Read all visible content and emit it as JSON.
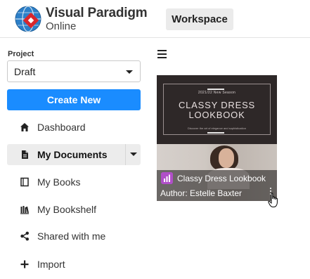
{
  "header": {
    "brand_line1": "Visual Paradigm",
    "brand_line2": "Online",
    "workspace_label": "Workspace"
  },
  "sidebar": {
    "project_label": "Project",
    "project_value": "Draft",
    "create_new_label": "Create New",
    "items": [
      {
        "label": "Dashboard",
        "icon": "home-icon"
      },
      {
        "label": "My Documents",
        "icon": "document-icon",
        "active": true
      },
      {
        "label": "My Books",
        "icon": "book-icon"
      },
      {
        "label": "My Bookshelf",
        "icon": "bookshelf-icon"
      },
      {
        "label": "Shared with me",
        "icon": "share-icon"
      },
      {
        "label": "Import",
        "icon": "plus-icon"
      }
    ]
  },
  "content": {
    "menu_icon": "hamburger-icon",
    "documents": [
      {
        "cover_tag": "2021/22 New Season",
        "cover_title_line1": "CLASSY DRESS",
        "cover_title_line2": "LOOKBOOK",
        "cover_subtitle": "Discover the art of elegance and sophistication",
        "title": "Classy Dress Lookbook",
        "author": "Author: Estelle Baxter"
      }
    ]
  },
  "colors": {
    "primary": "#1a8cff",
    "active_bg": "#ececec",
    "card_bg": "#2e2828",
    "doc_icon": "#b04fc8",
    "logo_red": "#d9262c",
    "logo_blue": "#2c7fc8"
  }
}
